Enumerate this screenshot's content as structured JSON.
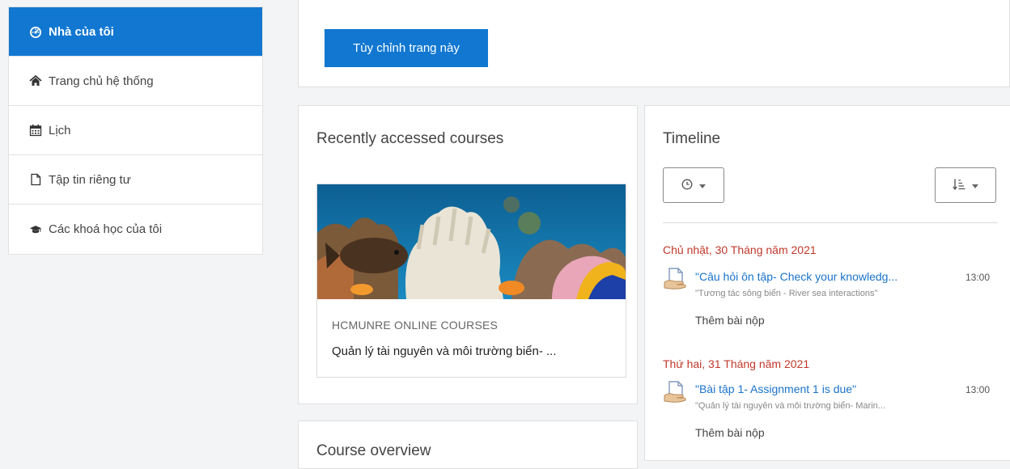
{
  "sidebar": {
    "items": [
      {
        "label": "Nhà của tôi",
        "icon": "dashboard-icon",
        "active": true
      },
      {
        "label": "Trang chủ hệ thống",
        "icon": "home-icon",
        "active": false
      },
      {
        "label": "Lịch",
        "icon": "calendar-icon",
        "active": false
      },
      {
        "label": "Tập tin riêng tư",
        "icon": "file-icon",
        "active": false
      },
      {
        "label": "Các khoá học của tôi",
        "icon": "graduation-cap-icon",
        "active": false
      }
    ]
  },
  "header": {
    "customize_label": "Tùy chỉnh trang này"
  },
  "recent": {
    "title": "Recently accessed courses",
    "course": {
      "category": "HCMUNRE ONLINE COURSES",
      "name": "Quản lý tài nguyên và môi trường biển- ..."
    }
  },
  "overview": {
    "title": "Course overview"
  },
  "timeline": {
    "title": "Timeline",
    "groups": [
      {
        "date": "Chủ nhật, 30 Tháng năm 2021",
        "event": "\"Câu hỏi ôn tập- Check your knowledg...",
        "course": "\"Tương tác sông biển - River sea interactions\"",
        "time": "13:00",
        "action": "Thêm bài nộp"
      },
      {
        "date": "Thứ hai, 31 Tháng năm 2021",
        "event": "\"Bài tập 1- Assignment 1 is due\"",
        "course": "\"Quản lý tài nguyên và môi trường biển- Marin...",
        "time": "13:00",
        "action": "Thêm bài nộp"
      }
    ]
  },
  "colors": {
    "accent": "#1177d1",
    "date_red": "#c1392b",
    "link_blue": "#1a73c9"
  }
}
